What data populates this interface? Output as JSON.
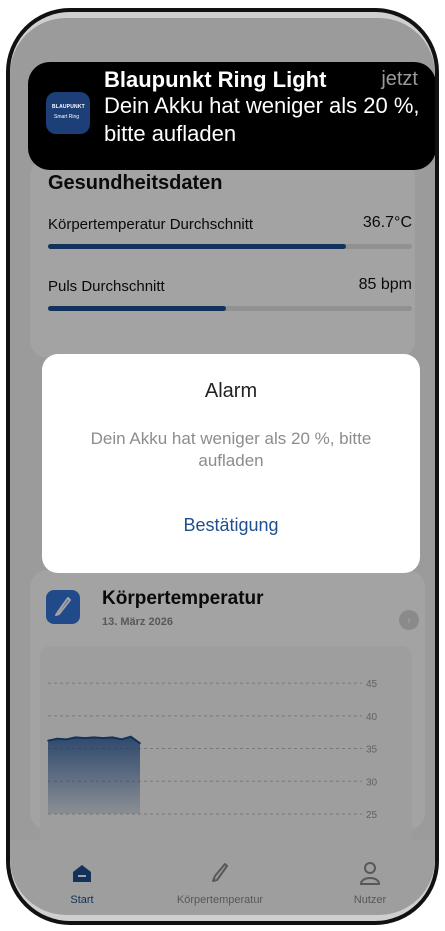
{
  "notification": {
    "app_name": "Blaupunkt Ring Light",
    "time": "jetzt",
    "message": "Dein Akku hat weniger als 20 %, bitte aufladen",
    "icon_brand": "BLAUPUNKT",
    "icon_subtitle": "Smart Ring"
  },
  "health": {
    "title": "Gesundheitsdaten",
    "metrics": [
      {
        "label": "Körpertemperatur Durchschnitt",
        "value": "36.7°C",
        "progress": 0.82
      },
      {
        "label": "Puls Durchschnitt",
        "value": "85 bpm",
        "progress": 0.49
      }
    ]
  },
  "alert": {
    "title": "Alarm",
    "message": "Dein Akku hat weniger als 20 %, bitte aufladen",
    "button": "Bestätigung"
  },
  "temperature_card": {
    "title": "Körpertemperatur",
    "date": "13. März 2026"
  },
  "chart_data": {
    "type": "area",
    "title": "",
    "xlabel": "",
    "ylabel": "",
    "ylim": [
      25,
      47
    ],
    "yticks": [
      "45",
      "40",
      "35",
      "30",
      "25"
    ],
    "series": [
      {
        "x": [
          0,
          1,
          2,
          3,
          4,
          5,
          6,
          7,
          8,
          9,
          10
        ],
        "values": [
          36.2,
          36.5,
          36.4,
          36.7,
          36.6,
          36.7,
          36.6,
          36.7,
          36.4,
          36.8,
          35.8
        ]
      }
    ],
    "grid": true,
    "colors": {
      "line": "#1f4f8f",
      "fill": "#2b5b9d"
    }
  },
  "nav": {
    "items": [
      {
        "label": "Start",
        "icon": "home-icon",
        "active": true
      },
      {
        "label": "Körpertemperatur",
        "icon": "thermometer-icon",
        "active": false
      },
      {
        "label": "Nutzer",
        "icon": "user-icon",
        "active": false
      }
    ]
  },
  "colors": {
    "accent": "#1f4f8f",
    "notification_bg": "#000000",
    "overlay": "rgba(0,0,0,0.36)"
  }
}
